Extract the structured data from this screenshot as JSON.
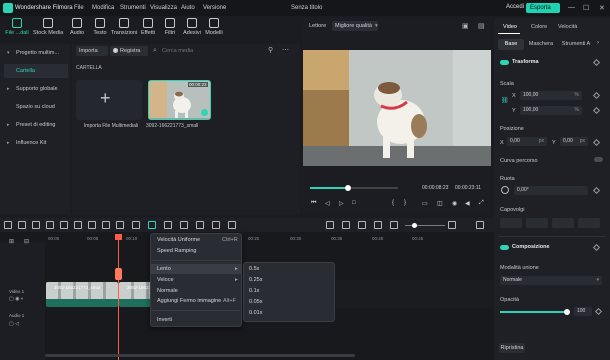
{
  "app": {
    "name": "Wondershare Filmora",
    "doc_title": "Senza titolo"
  },
  "menu": [
    "File",
    "Modifica",
    "Strumenti",
    "Visualizza",
    "Aiuto",
    "Versione"
  ],
  "account": {
    "login": "Accedi",
    "export": "Esporta"
  },
  "toolbar": [
    {
      "label": "File ...dali",
      "icon": "media-icon"
    },
    {
      "label": "Stock Media",
      "icon": "stock-icon"
    },
    {
      "label": "Audio",
      "icon": "music-icon"
    },
    {
      "label": "Testo",
      "icon": "text-icon"
    },
    {
      "label": "Transizioni",
      "icon": "transition-icon"
    },
    {
      "label": "Effetti",
      "icon": "effects-icon"
    },
    {
      "label": "Filtri",
      "icon": "filter-icon"
    },
    {
      "label": "Adesivi",
      "icon": "sticker-icon"
    },
    {
      "label": "Modelli",
      "icon": "template-icon"
    }
  ],
  "leftnav": [
    {
      "label": "Progetto multim..."
    },
    {
      "label": "Cartella"
    },
    {
      "label": "Supporto globale"
    },
    {
      "label": "Spazio su cloud"
    },
    {
      "label": "Preset di editing"
    },
    {
      "label": "Influence Kit"
    }
  ],
  "media": {
    "import_btn": "Importa",
    "record_btn": "Registra",
    "search_placeholder": "Cerca media",
    "folder": "CARTELLA",
    "import_tile": "Importa File Multimediali",
    "clip_name": "3092-166221773_small",
    "clip_duration": "00:00:23"
  },
  "preview": {
    "label": "Lettore",
    "quality": "Migliore qualità",
    "time_current": "00:00:08:23",
    "time_sep": "/",
    "time_total": "00:00:23:11",
    "progress": 0.37
  },
  "panel": {
    "tabs": [
      "Video",
      "Colore",
      "Velocità"
    ],
    "subtabs": [
      "Base",
      "Maschera",
      "Strumenti A"
    ],
    "transform": "Trasforma",
    "scale": "Scala",
    "scale_x": "100,00",
    "scale_y": "100,00",
    "percent": "%",
    "position": "Posizione",
    "pos_x": "0,00",
    "pos_y": "0,00",
    "px": "px",
    "x": "X",
    "y": "Y",
    "curve": "Curva percorso",
    "rotate": "Ruota",
    "rotate_value": "0,00°",
    "flip": "Capovolgi",
    "compositing": "Composizione",
    "blend_mode": "Modalità unione",
    "blend_value": "Normale",
    "opacity": "Opacità",
    "opacity_value": "100",
    "opacity_level": 1.0,
    "reset": "Ripristina"
  },
  "timeline": {
    "ticks": [
      "00:00",
      "00:05",
      "00:10",
      "00:15",
      "00:20",
      "00:25",
      "00:30",
      "00:35",
      "00:40",
      "00:45"
    ],
    "tracks": [
      {
        "label": "Video 1"
      },
      {
        "label": "Audio 1"
      }
    ],
    "clip_names": [
      "3092-166221773_smal",
      "3092-166221773_small"
    ]
  },
  "context_menu": {
    "items": [
      {
        "label": "Velocità Uniforme",
        "shortcut": "Ctrl+R"
      },
      {
        "label": "Speed Ramping",
        "shortcut": ""
      },
      {
        "label": "Lento",
        "shortcut": "▸"
      },
      {
        "label": "Veloce",
        "shortcut": "▸"
      },
      {
        "label": "Normale",
        "shortcut": ""
      },
      {
        "label": "Aggiungi Fermo immagine",
        "shortcut": "Alt+F"
      },
      {
        "label": "Inverti",
        "shortcut": ""
      }
    ],
    "submenu": [
      "0.5x",
      "0.25x",
      "0.1x",
      "0.05x",
      "0.01x"
    ]
  }
}
